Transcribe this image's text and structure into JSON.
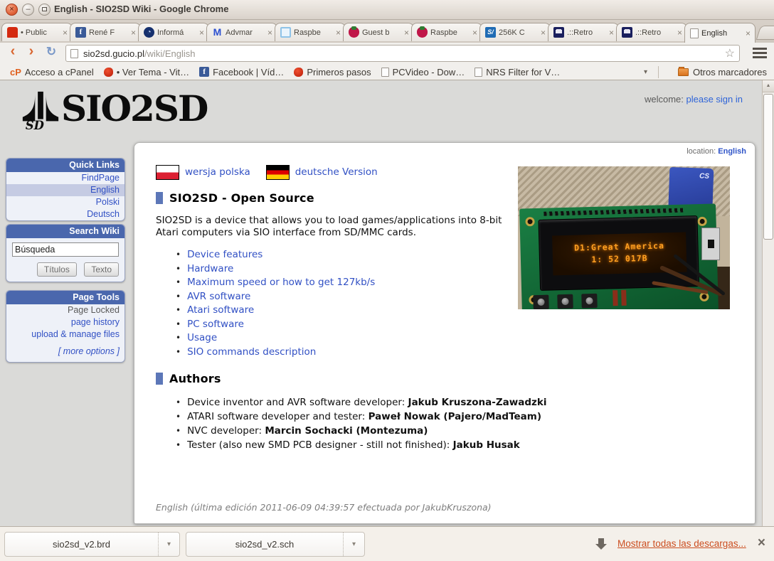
{
  "window": {
    "title": "English - SIO2SD Wiki - Google Chrome"
  },
  "tabs": [
    {
      "label": "• Public",
      "icon": "pixel-creature-icon"
    },
    {
      "label": "René F",
      "icon": "facebook-icon"
    },
    {
      "label": "Informá",
      "icon": "swirl-icon"
    },
    {
      "label": "Advmar",
      "icon": "letter-m-icon"
    },
    {
      "label": "Raspbe",
      "icon": "cube-icon"
    },
    {
      "label": "Guest b",
      "icon": "raspberry-icon"
    },
    {
      "label": "Raspbe",
      "icon": "raspberry-icon"
    },
    {
      "label": "256K C",
      "icon": "scribd-icon"
    },
    {
      "label": ".::Retro",
      "icon": "invader-icon"
    },
    {
      "label": ".::Retro",
      "icon": "invader-icon"
    },
    {
      "label": "English",
      "icon": "document-icon"
    }
  ],
  "icons": {
    "back": "‹",
    "forward": "›",
    "reload": "↻",
    "star": "☆",
    "close": "×",
    "scroll_up": "▲",
    "dropdown": "▾",
    "facebook_letter": "f",
    "advmar_letter": "M",
    "scribd_text": "S/",
    "cpanel_text": "cP"
  },
  "toolbar": {
    "url_host": "sio2sd.gucio.pl",
    "url_path": "/wiki/English"
  },
  "bookmarks": {
    "items": [
      {
        "label": "Acceso a cPanel"
      },
      {
        "label": "• Ver Tema - Vit…"
      },
      {
        "label": "Facebook | Víd…"
      },
      {
        "label": "Primeros pasos"
      },
      {
        "label": "PCVideo - Dow…"
      },
      {
        "label": "NRS Filter for V…"
      }
    ],
    "other_label": "Otros marcadores"
  },
  "page": {
    "logo_text": "SIO2SD",
    "logo_sd": "SD",
    "welcome_label": "welcome:",
    "sign_in_link": "please sign in",
    "location_label": "location:",
    "location_value": "English",
    "sidebar": {
      "quick_links": {
        "title": "Quick Links",
        "items": [
          "FindPage",
          "English",
          "Polski",
          "Deutsch"
        ]
      },
      "search": {
        "title": "Search Wiki",
        "value": "Búsqueda",
        "titles_button": "Títulos",
        "text_button": "Texto"
      },
      "page_tools": {
        "title": "Page Tools",
        "locked": "Page Locked",
        "links": [
          "page history",
          "upload & manage files"
        ],
        "more": "[ more options ]"
      }
    },
    "content": {
      "lang_links": {
        "pl": "wersja polska",
        "de": "deutsche Version"
      },
      "heading1": "SIO2SD - Open Source",
      "intro": "SIO2SD is a device that allows you to load games/applications into 8-bit Atari computers via SIO interface from SD/MMC cards.",
      "links": [
        "Device features",
        "Hardware",
        "Maximum speed or how to get 127kb/s",
        "AVR software",
        "Atari software",
        "PC software",
        "Usage",
        "SIO commands description"
      ],
      "heading2": "Authors",
      "authors": [
        {
          "role": "Device inventor and AVR software developer: ",
          "name": "Jakub Kruszona-Zawadzki"
        },
        {
          "role": "ATARI software developer and tester: ",
          "name": "Paweł Nowak (Pajero/MadTeam)"
        },
        {
          "role": "NVC developer: ",
          "name": "Marcin Sochacki (Montezuma)"
        },
        {
          "role": "Tester (also new SMD PCB designer - still not finished): ",
          "name": "Jakub Husak"
        }
      ],
      "footer": "English (última edición 2011-06-09 04:39:57 efectuada por JakubKruszona)",
      "photo": {
        "lcd_line1": "D1:Great America",
        "lcd_line2": "1: 52 017B",
        "sd_label": "CS"
      }
    }
  },
  "download_bar": {
    "files": [
      "sio2sd_v2.brd",
      "sio2sd_v2.sch"
    ],
    "show_all": "Mostrar todas las descargas...",
    "colors": {
      "link": "#cc4e20"
    }
  },
  "colors": {
    "wiki_link": "#3150c4",
    "sidebar_header": "#4a67ad",
    "heading_marker": "#5c77b8",
    "lcd_text": "#ffa022",
    "ubuntu_orange": "#dd4814"
  }
}
